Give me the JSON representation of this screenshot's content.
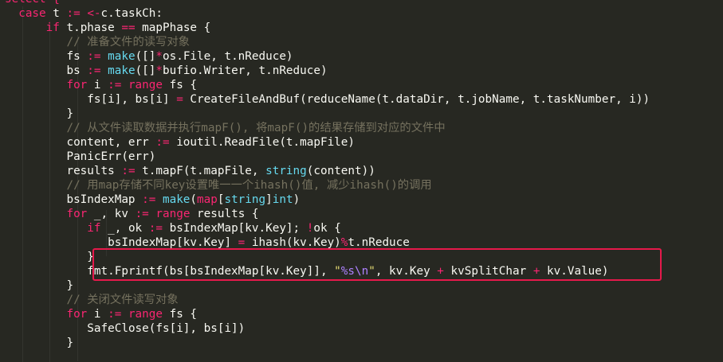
{
  "code": {
    "lines": [
      {
        "indent": "",
        "tokens": [
          {
            "t": "select {",
            "c": "kw"
          }
        ]
      },
      {
        "indent": "  ",
        "tokens": [
          {
            "t": "case",
            "c": "kw"
          },
          {
            "t": " t ",
            "c": "plain"
          },
          {
            "t": ":=",
            "c": "op"
          },
          {
            "t": " ",
            "c": "plain"
          },
          {
            "t": "<-",
            "c": "op"
          },
          {
            "t": "c.taskCh:",
            "c": "plain"
          }
        ]
      },
      {
        "indent": "      ",
        "tokens": [
          {
            "t": "if",
            "c": "kw"
          },
          {
            "t": " t.phase ",
            "c": "plain"
          },
          {
            "t": "==",
            "c": "op"
          },
          {
            "t": " mapPhase {",
            "c": "plain"
          }
        ]
      },
      {
        "indent": "         ",
        "tokens": [
          {
            "t": "// 准备文件的读写对象",
            "c": "cmt"
          }
        ]
      },
      {
        "indent": "         ",
        "tokens": [
          {
            "t": "fs ",
            "c": "plain"
          },
          {
            "t": ":=",
            "c": "op"
          },
          {
            "t": " ",
            "c": "plain"
          },
          {
            "t": "make",
            "c": "fn"
          },
          {
            "t": "([]",
            "c": "plain"
          },
          {
            "t": "*",
            "c": "op"
          },
          {
            "t": "os.File, t.nReduce)",
            "c": "plain"
          }
        ]
      },
      {
        "indent": "         ",
        "tokens": [
          {
            "t": "bs ",
            "c": "plain"
          },
          {
            "t": ":=",
            "c": "op"
          },
          {
            "t": " ",
            "c": "plain"
          },
          {
            "t": "make",
            "c": "fn"
          },
          {
            "t": "([]",
            "c": "plain"
          },
          {
            "t": "*",
            "c": "op"
          },
          {
            "t": "bufio.Writer, t.nReduce)",
            "c": "plain"
          }
        ]
      },
      {
        "indent": "         ",
        "tokens": [
          {
            "t": "for",
            "c": "kw"
          },
          {
            "t": " i ",
            "c": "plain"
          },
          {
            "t": ":=",
            "c": "op"
          },
          {
            "t": " ",
            "c": "plain"
          },
          {
            "t": "range",
            "c": "kw"
          },
          {
            "t": " fs {",
            "c": "plain"
          }
        ]
      },
      {
        "indent": "            ",
        "tokens": [
          {
            "t": "fs[i], bs[i] ",
            "c": "plain"
          },
          {
            "t": "=",
            "c": "op"
          },
          {
            "t": " CreateFileAndBuf(reduceName(t.dataDir, t.jobName, t.taskNumber, i))",
            "c": "plain"
          }
        ]
      },
      {
        "indent": "         ",
        "tokens": [
          {
            "t": "}",
            "c": "plain"
          }
        ]
      },
      {
        "indent": "         ",
        "tokens": [
          {
            "t": "// 从文件读取数据并执行mapF(), 将mapF()的结果存储到对应的文件中",
            "c": "cmt"
          }
        ]
      },
      {
        "indent": "         ",
        "tokens": [
          {
            "t": "content, err ",
            "c": "plain"
          },
          {
            "t": ":=",
            "c": "op"
          },
          {
            "t": " ioutil.ReadFile(t.mapFile)",
            "c": "plain"
          }
        ]
      },
      {
        "indent": "         ",
        "tokens": [
          {
            "t": "PanicErr(err)",
            "c": "plain"
          }
        ]
      },
      {
        "indent": "         ",
        "tokens": [
          {
            "t": "results ",
            "c": "plain"
          },
          {
            "t": ":=",
            "c": "op"
          },
          {
            "t": " t.mapF(t.mapFile, ",
            "c": "plain"
          },
          {
            "t": "string",
            "c": "ty"
          },
          {
            "t": "(content))",
            "c": "plain"
          }
        ]
      },
      {
        "indent": "         ",
        "tokens": [
          {
            "t": "// 用map存储不同key设置唯一一个ihash()值, 减少ihash()的调用",
            "c": "cmt"
          }
        ]
      },
      {
        "indent": "         ",
        "tokens": [
          {
            "t": "bsIndexMap ",
            "c": "plain"
          },
          {
            "t": ":=",
            "c": "op"
          },
          {
            "t": " ",
            "c": "plain"
          },
          {
            "t": "make",
            "c": "fn"
          },
          {
            "t": "(",
            "c": "plain"
          },
          {
            "t": "map",
            "c": "kw"
          },
          {
            "t": "[",
            "c": "plain"
          },
          {
            "t": "string",
            "c": "ty"
          },
          {
            "t": "]",
            "c": "plain"
          },
          {
            "t": "int",
            "c": "ty"
          },
          {
            "t": ")",
            "c": "plain"
          }
        ]
      },
      {
        "indent": "         ",
        "tokens": [
          {
            "t": "for",
            "c": "kw"
          },
          {
            "t": " _, kv ",
            "c": "plain"
          },
          {
            "t": ":=",
            "c": "op"
          },
          {
            "t": " ",
            "c": "plain"
          },
          {
            "t": "range",
            "c": "kw"
          },
          {
            "t": " results {",
            "c": "plain"
          }
        ]
      },
      {
        "indent": "            ",
        "tokens": [
          {
            "t": "if",
            "c": "kw"
          },
          {
            "t": " _, ok ",
            "c": "plain"
          },
          {
            "t": ":=",
            "c": "op"
          },
          {
            "t": " bsIndexMap[kv.Key]; ",
            "c": "plain"
          },
          {
            "t": "!",
            "c": "op"
          },
          {
            "t": "ok {",
            "c": "plain"
          }
        ]
      },
      {
        "indent": "               ",
        "tokens": [
          {
            "t": "bsIndexMap[kv.Key] ",
            "c": "plain"
          },
          {
            "t": "=",
            "c": "op"
          },
          {
            "t": " ihash(kv.Key)",
            "c": "plain"
          },
          {
            "t": "%",
            "c": "op"
          },
          {
            "t": "t.nReduce",
            "c": "plain"
          }
        ]
      },
      {
        "indent": "            ",
        "tokens": [
          {
            "t": "}",
            "c": "plain"
          }
        ]
      },
      {
        "indent": "            ",
        "tokens": [
          {
            "t": "fmt.Fprintf(bs[bsIndexMap[kv.Key]], ",
            "c": "plain"
          },
          {
            "t": "\"",
            "c": "str"
          },
          {
            "t": "%s\\n",
            "c": "strEsc"
          },
          {
            "t": "\"",
            "c": "str"
          },
          {
            "t": ", kv.Key ",
            "c": "plain"
          },
          {
            "t": "+",
            "c": "op"
          },
          {
            "t": " kvSplitChar ",
            "c": "plain"
          },
          {
            "t": "+",
            "c": "op"
          },
          {
            "t": " kv.Value)",
            "c": "plain"
          }
        ]
      },
      {
        "indent": "         ",
        "tokens": [
          {
            "t": "}",
            "c": "plain"
          }
        ]
      },
      {
        "indent": "         ",
        "tokens": [
          {
            "t": "// 关闭文件读写对象",
            "c": "cmt"
          }
        ]
      },
      {
        "indent": "         ",
        "tokens": [
          {
            "t": "for",
            "c": "kw"
          },
          {
            "t": " i ",
            "c": "plain"
          },
          {
            "t": ":=",
            "c": "op"
          },
          {
            "t": " ",
            "c": "plain"
          },
          {
            "t": "range",
            "c": "kw"
          },
          {
            "t": " fs {",
            "c": "plain"
          }
        ]
      },
      {
        "indent": "            ",
        "tokens": [
          {
            "t": "SafeClose(fs[i], bs[i])",
            "c": "plain"
          }
        ]
      },
      {
        "indent": "         ",
        "tokens": [
          {
            "t": "}",
            "c": "plain"
          }
        ]
      }
    ]
  }
}
